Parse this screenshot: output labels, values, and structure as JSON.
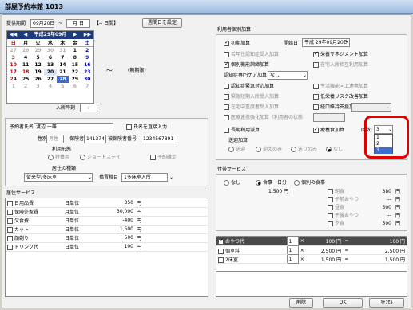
{
  "window": {
    "title": "部屋予約本館 1013"
  },
  "period": {
    "label": "提供期間",
    "start": "09月20日",
    "tilde": "～",
    "end": "月 日",
    "days": "【-- 日間】",
    "repeat_button": "週間日を設定"
  },
  "calendar": {
    "header": "平成29年09月",
    "prev_year": "◀◀",
    "prev_month": "◀",
    "next_month": "▶",
    "next_year": "▶▶",
    "weekdays": [
      "日",
      "月",
      "火",
      "水",
      "木",
      "金",
      "土"
    ],
    "weeks": [
      [
        "27",
        "28",
        "29",
        "30",
        "31",
        "1",
        "2"
      ],
      [
        "3",
        "4",
        "5",
        "6",
        "7",
        "8",
        "9"
      ],
      [
        "10",
        "11",
        "12",
        "13",
        "14",
        "15",
        "16"
      ],
      [
        "17",
        "18",
        "19",
        "20",
        "21",
        "22",
        "23"
      ],
      [
        "24",
        "25",
        "26",
        "27",
        "28",
        "29",
        "30"
      ],
      [
        "1",
        "2",
        "3",
        "4",
        "5",
        "6",
        "7"
      ]
    ],
    "tilde": "～",
    "unlimited": "(無期限)",
    "entry_time_label": "入所時刻",
    "entry_time_value": ":"
  },
  "reserver": {
    "name_label": "予約者氏名",
    "name_value": "渡辺 一雄",
    "direct_entry_label": "氏名を直接入力",
    "gender_label": "性別",
    "gender_value": "男性",
    "insurer_label": "保険者",
    "insurer_value": "141374",
    "insured_no_label": "被保険者番号",
    "insured_no_value": "1234567891",
    "usage_label": "利用形態",
    "usage_options": [
      "特養用",
      "ショートステイ"
    ],
    "confirmed_label": "予約確定",
    "room_type_label": "居住の種類",
    "room_type_value": "従来型/多床室",
    "care_area_label": "措置種目",
    "care_area_value": "1多床室入所"
  },
  "residence_services": {
    "title": "居住サービス",
    "items": [
      {
        "name": "日用品費",
        "unit": "日単位",
        "price": "350",
        "yen": "円",
        "checked": false
      },
      {
        "name": "保険外家賃",
        "unit": "月単位",
        "price": "30,000",
        "yen": "円",
        "checked": false
      },
      {
        "name": "欠食費",
        "unit": "日単位",
        "price": "-400",
        "yen": "円",
        "checked": false
      },
      {
        "name": "カット",
        "unit": "日単位",
        "price": "1,500",
        "yen": "円",
        "checked": false
      },
      {
        "name": "顔剃り",
        "unit": "日単位",
        "price": "500",
        "yen": "円",
        "checked": false
      },
      {
        "name": "ドリンク代",
        "unit": "日単位",
        "price": "100",
        "yen": "円",
        "checked": false
      }
    ]
  },
  "additions": {
    "title": "利用者個別加算",
    "items": [
      {
        "label": "初期加算",
        "checked": true
      },
      {
        "label": "若年性認知症受入加算",
        "checked": false
      },
      {
        "label": "個別機能訓練加算",
        "checked": true
      },
      {
        "label": "認知症専門ケア加算",
        "checked": false
      },
      {
        "label": "認知症緊急対応加算",
        "checked": false
      },
      {
        "label": "緊急短期入所受入加算",
        "checked": false
      },
      {
        "label": "在宅中重度者受入加算",
        "checked": false
      },
      {
        "label": "医療連携強化加算（利用者の状態",
        "checked": false
      },
      {
        "label": "長期利用減算",
        "checked": false
      }
    ],
    "start_date_label": "開始日",
    "start_date_value": "平成 29年09月20日",
    "nutrition_label": "栄養マネジメント加算",
    "home_return_label": "在宅入所相互利用加算",
    "dementia_care_select": "なし",
    "life_support_label": "生活機能向上連携加算",
    "low_nutrition_label": "低栄養リスク改善加算",
    "oral_transition_label": "経口移行加算",
    "oral_support_label": "経口維持支援加算",
    "therapy_food_label": "療養食加算",
    "count_label": "回数:",
    "count_value": "3",
    "count_options": [
      "1",
      "2",
      "3"
    ],
    "transport_title": "送迎加算",
    "transport_options": [
      "送迎",
      "迎えのみ",
      "送りのみ",
      "なし"
    ]
  },
  "meals": {
    "title": "付帯サービス",
    "options": [
      "なし",
      "食事一日分",
      "個別の食事"
    ],
    "daily_price": "1,500 円",
    "items": [
      {
        "name": "朝食",
        "price": "380",
        "yen": "円"
      },
      {
        "name": "午前おやつ",
        "price": "---",
        "yen": "円"
      },
      {
        "name": "昼食",
        "price": "500",
        "yen": "円"
      },
      {
        "name": "午後おやつ",
        "price": "---",
        "yen": "円"
      },
      {
        "name": "夕食",
        "price": "500",
        "yen": "円"
      }
    ]
  },
  "extra_services": {
    "items": [
      {
        "name": "おやつ代",
        "qty": "1",
        "times": "×",
        "price": "100 円",
        "eq": "=",
        "total": "100 円",
        "checked": true
      },
      {
        "name": "個室料",
        "qty": "1",
        "times": "×",
        "price": "2,500 円",
        "eq": "=",
        "total": "2,500 円",
        "checked": false
      },
      {
        "name": "2床室",
        "qty": "1",
        "times": "×",
        "price": "1,500 円",
        "eq": "=",
        "total": "1,500 円",
        "checked": false
      }
    ]
  },
  "footer": {
    "delete": "削除",
    "ok": "OK",
    "cancel": "ｷｬﾝｾﾙ"
  },
  "highlight_color": "#e00000"
}
